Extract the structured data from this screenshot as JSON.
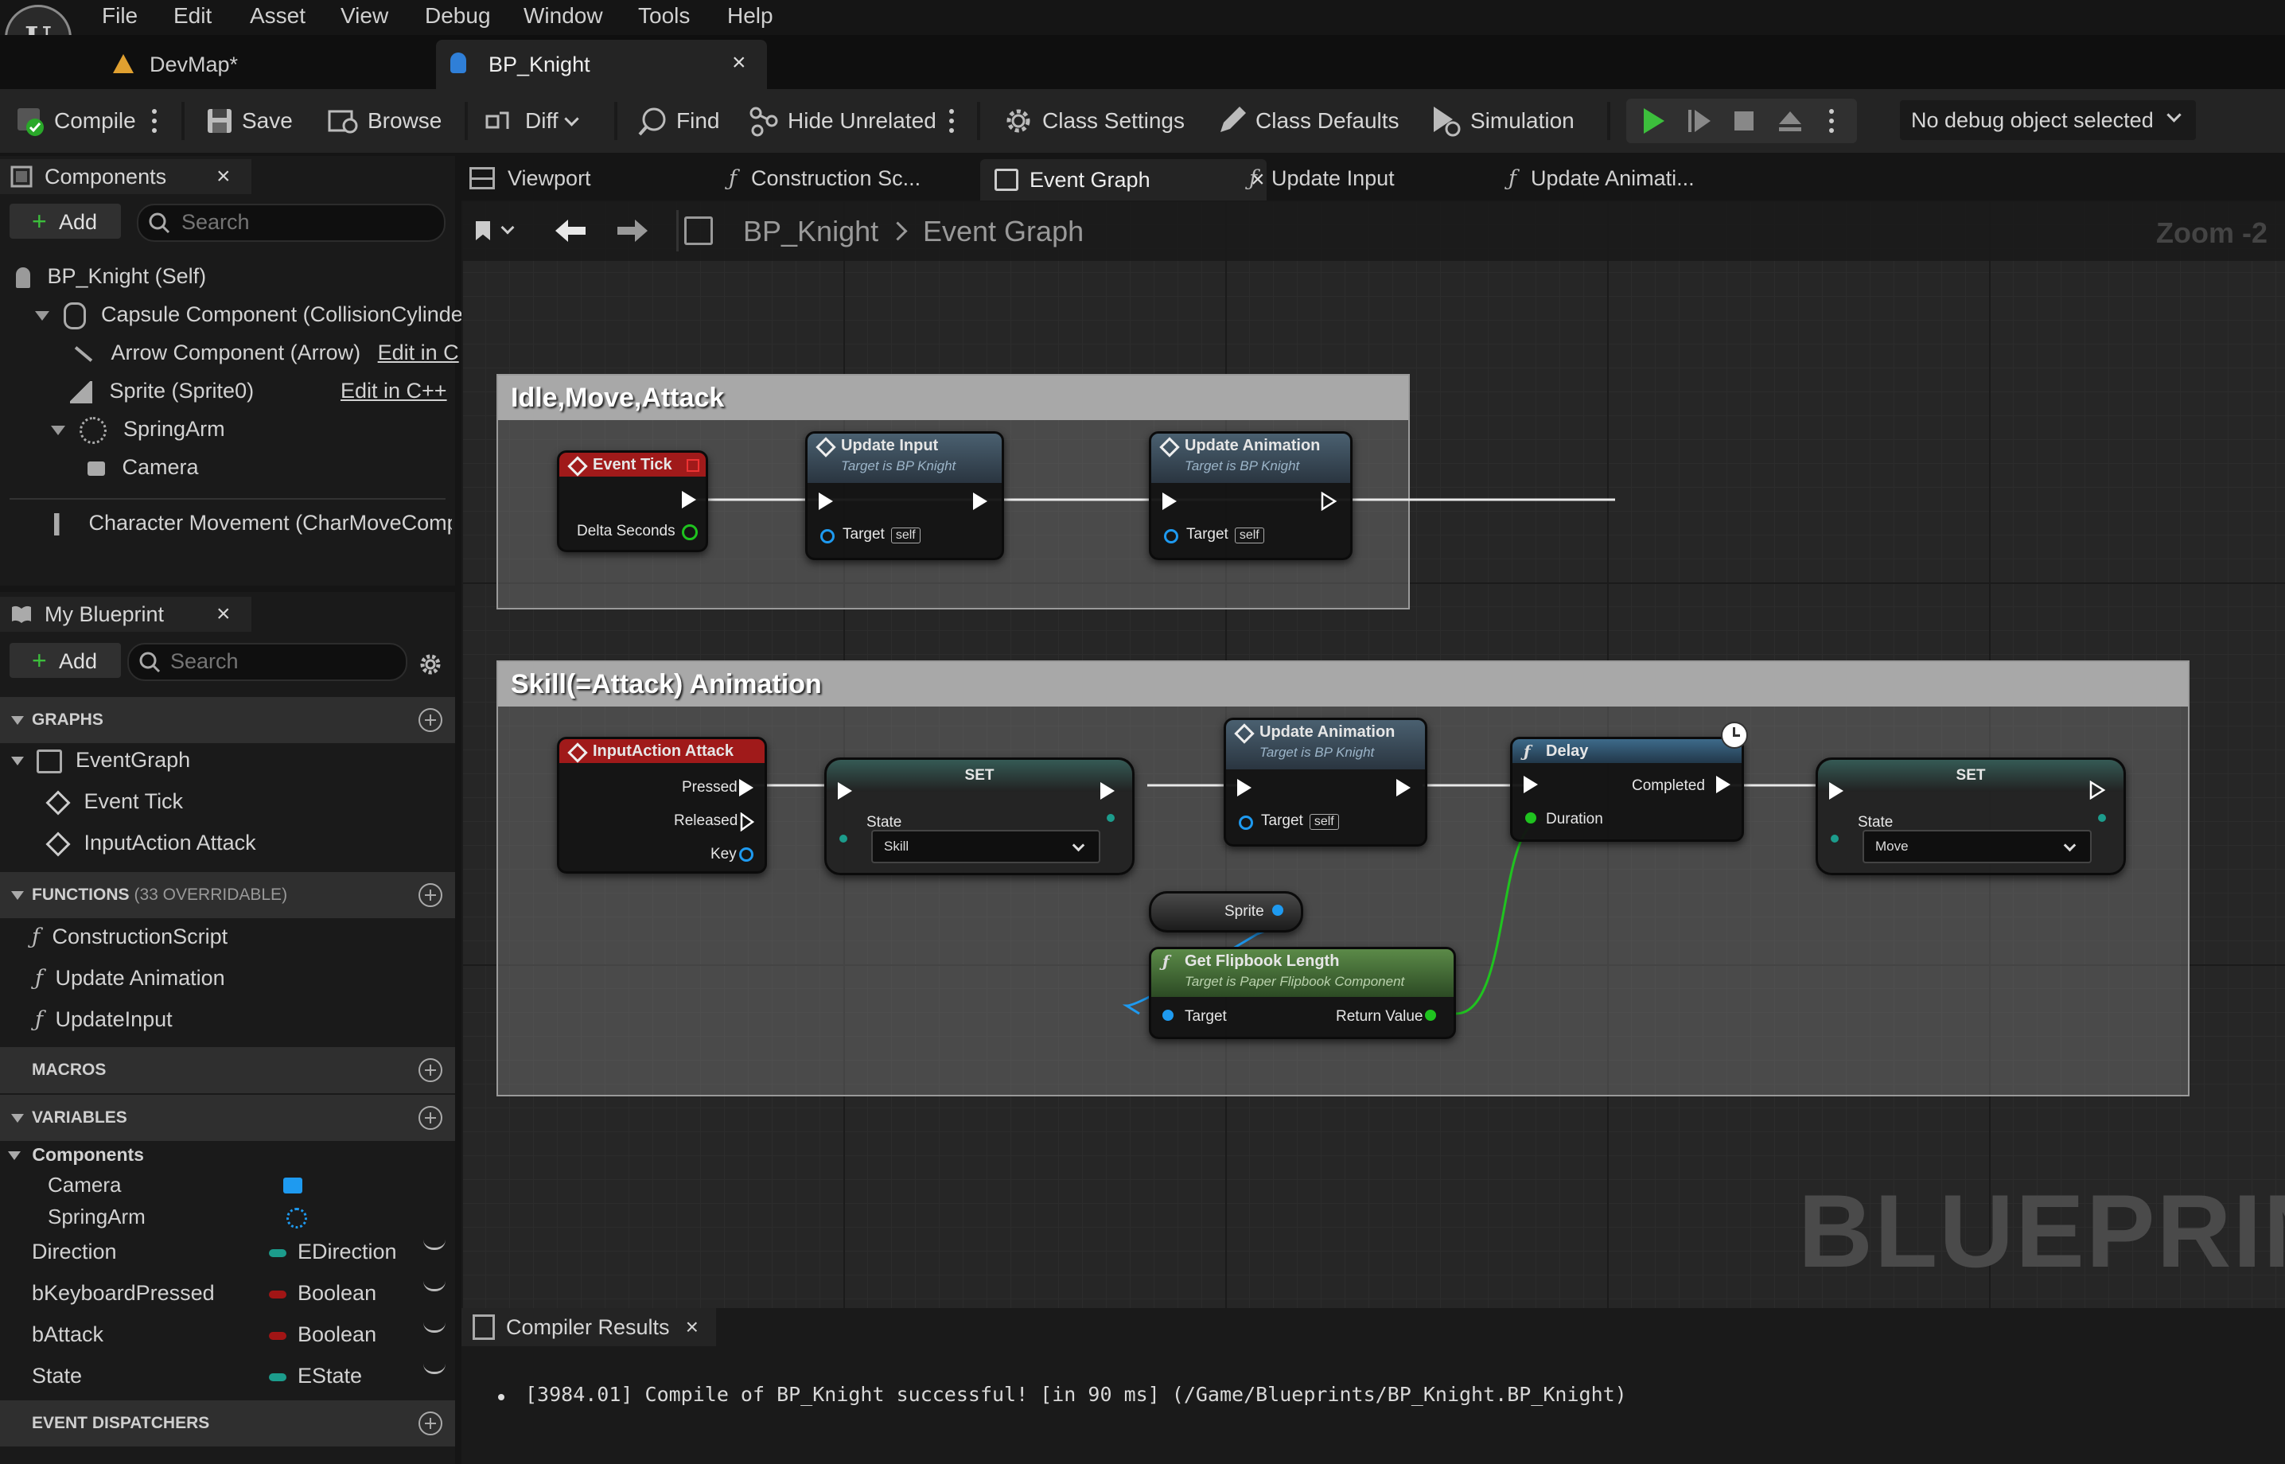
{
  "menu": {
    "logo": "unreal-logo",
    "items": [
      "File",
      "Edit",
      "Asset",
      "View",
      "Debug",
      "Window",
      "Tools",
      "Help"
    ]
  },
  "doc_tabs": [
    {
      "label": "DevMap*",
      "icon": "map-icon"
    },
    {
      "label": "BP_Knight",
      "icon": "blueprint-icon",
      "close": "×"
    }
  ],
  "toolbar": {
    "compile": "Compile",
    "save": "Save",
    "browse": "Browse",
    "diff": "Diff",
    "find": "Find",
    "hide_unrelated": "Hide Unrelated",
    "class_settings": "Class Settings",
    "class_defaults": "Class Defaults",
    "simulation": "Simulation",
    "debug_select": "No debug object selected"
  },
  "components": {
    "title": "Components",
    "close": "×",
    "add": "Add",
    "search_placeholder": "Search",
    "tree": [
      {
        "label": "BP_Knight (Self)",
        "icon": "actor-icon"
      },
      {
        "label": "Capsule Component (CollisionCylinde",
        "icon": "capsule-icon"
      },
      {
        "label": "Arrow Component (Arrow)",
        "extra": "Edit in C",
        "icon": "arrow-icon"
      },
      {
        "label": "Sprite (Sprite0)",
        "extra": "Edit in C++",
        "icon": "sprite-icon"
      },
      {
        "label": "SpringArm",
        "icon": "springarm-icon"
      },
      {
        "label": "Camera",
        "icon": "camera-icon"
      },
      {
        "label": "Character Movement (CharMoveComp",
        "icon": "movement-icon"
      }
    ]
  },
  "my_blueprint": {
    "title": "My Blueprint",
    "close": "×",
    "add": "Add",
    "search_placeholder": "Search",
    "graphs_header": "GRAPHS",
    "graphs": [
      "EventGraph",
      "Event Tick",
      "InputAction Attack"
    ],
    "functions_header": "FUNCTIONS",
    "functions_count": "(33 OVERRIDABLE)",
    "functions": [
      "ConstructionScript",
      "Update Animation",
      "UpdateInput"
    ],
    "macros_header": "MACROS",
    "variables_header": "VARIABLES",
    "components_group": "Components",
    "component_vars": [
      {
        "name": "Camera"
      },
      {
        "name": "SpringArm"
      }
    ],
    "vars": [
      {
        "name": "Direction",
        "type": "EDirection",
        "color": "#1c9c8c"
      },
      {
        "name": "bKeyboardPressed",
        "type": "Boolean",
        "color": "#a11515"
      },
      {
        "name": "bAttack",
        "type": "Boolean",
        "color": "#a11515"
      },
      {
        "name": "State",
        "type": "EState",
        "color": "#1c9c8c"
      }
    ],
    "dispatchers_header": "EVENT DISPATCHERS"
  },
  "graph_tabs": [
    {
      "label": "Viewport",
      "icon": "viewport-icon"
    },
    {
      "label": "Construction Sc...",
      "icon": "function-icon"
    },
    {
      "label": "Event Graph",
      "icon": "graph-icon",
      "close": "×"
    },
    {
      "label": "Update Input",
      "icon": "function-icon"
    },
    {
      "label": "Update Animati...",
      "icon": "function-icon"
    }
  ],
  "breadcrumb": {
    "root": "BP_Knight",
    "sep": ">",
    "current": "Event Graph",
    "zoom": "Zoom -2"
  },
  "watermark": "BLUEPRINT",
  "comments": [
    {
      "title": "Idle,Move,Attack"
    },
    {
      "title": "Skill(=Attack) Animation"
    }
  ],
  "nodes": {
    "event_tick": {
      "title": "Event Tick",
      "pin": "Delta Seconds"
    },
    "update_input": {
      "title": "Update Input",
      "subtitle": "Target is BP Knight",
      "target": "Target",
      "self": "self"
    },
    "update_anim_1": {
      "title": "Update Animation",
      "subtitle": "Target is BP Knight",
      "target": "Target",
      "self": "self"
    },
    "input_attack": {
      "title": "InputAction Attack",
      "pressed": "Pressed",
      "released": "Released",
      "key": "Key"
    },
    "set_1": {
      "title": "SET",
      "label": "State",
      "value": "Skill"
    },
    "update_anim_2": {
      "title": "Update Animation",
      "subtitle": "Target is BP Knight",
      "target": "Target",
      "self": "self"
    },
    "delay": {
      "title": "Delay",
      "completed": "Completed",
      "duration": "Duration"
    },
    "set_2": {
      "title": "SET",
      "label": "State",
      "value": "Move"
    },
    "sprite": {
      "label": "Sprite"
    },
    "flipbook": {
      "title": "Get Flipbook Length",
      "subtitle": "Target is Paper Flipbook Component",
      "target": "Target",
      "ret": "Return Value"
    }
  },
  "compiler": {
    "title": "Compiler Results",
    "close": "×",
    "message": "[3984.01] Compile of BP_Knight successful! [in 90 ms] (/Game/Blueprints/BP_Knight.BP_Knight)"
  }
}
